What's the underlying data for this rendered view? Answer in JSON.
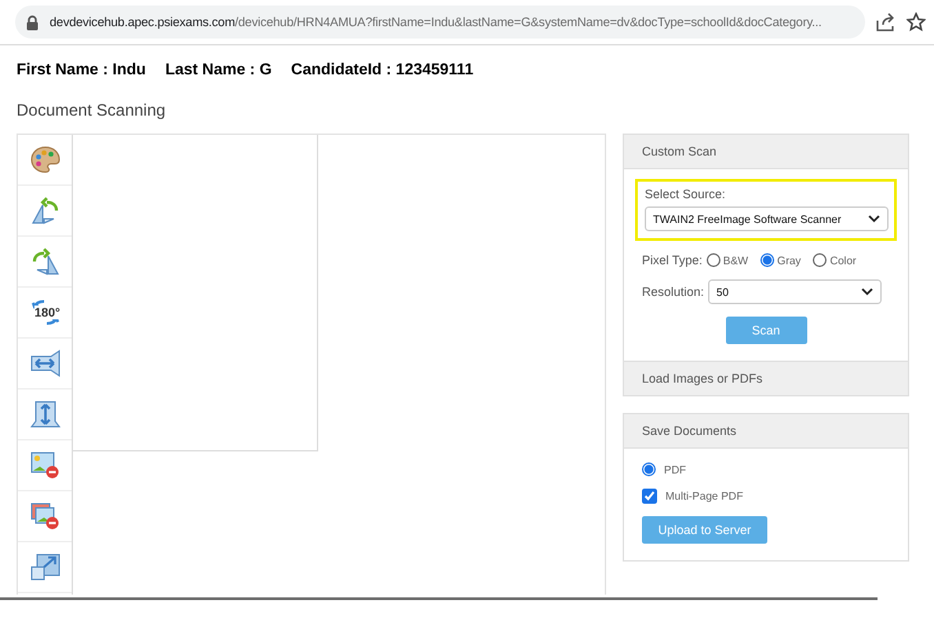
{
  "address_bar": {
    "host": "devdevicehub.apec.psiexams.com",
    "path": "/devicehub/HRN4AMUA?firstName=Indu&lastName=G&systemName=dv&docType=schoolId&docCategory..."
  },
  "candidate": [
    {
      "label": "First Name : Indu"
    },
    {
      "label": "Last Name : G"
    },
    {
      "label": "CandidateId : 123459111"
    }
  ],
  "page_title": "Document Scanning",
  "tools": [
    {
      "kind": "palette"
    },
    {
      "kind": "rotate-left"
    },
    {
      "kind": "rotate-right"
    },
    {
      "kind": "rotate-180",
      "label": "180°"
    },
    {
      "kind": "mirror"
    },
    {
      "kind": "flip"
    },
    {
      "kind": "remove"
    },
    {
      "kind": "remove-all"
    },
    {
      "kind": "resize"
    }
  ],
  "custom_scan": {
    "title": "Custom Scan",
    "source_label": "Select Source:",
    "source": "TWAIN2 FreeImage Software Scanner",
    "highlighted": true,
    "pixel_type_label": "Pixel Type:",
    "pixel_types": [
      {
        "label": "B&W",
        "selected": false
      },
      {
        "label": "Gray",
        "selected": true
      },
      {
        "label": "Color",
        "selected": false
      }
    ],
    "resolution_label": "Resolution:",
    "resolution": "50",
    "scan_button": "Scan"
  },
  "load_section": {
    "title": "Load Images or PDFs"
  },
  "save_documents": {
    "title": "Save Documents",
    "formats": [
      {
        "label": "PDF",
        "selected": true
      }
    ],
    "multi_page": {
      "label": "Multi-Page PDF",
      "checked": true
    },
    "upload_button": "Upload to Server"
  }
}
